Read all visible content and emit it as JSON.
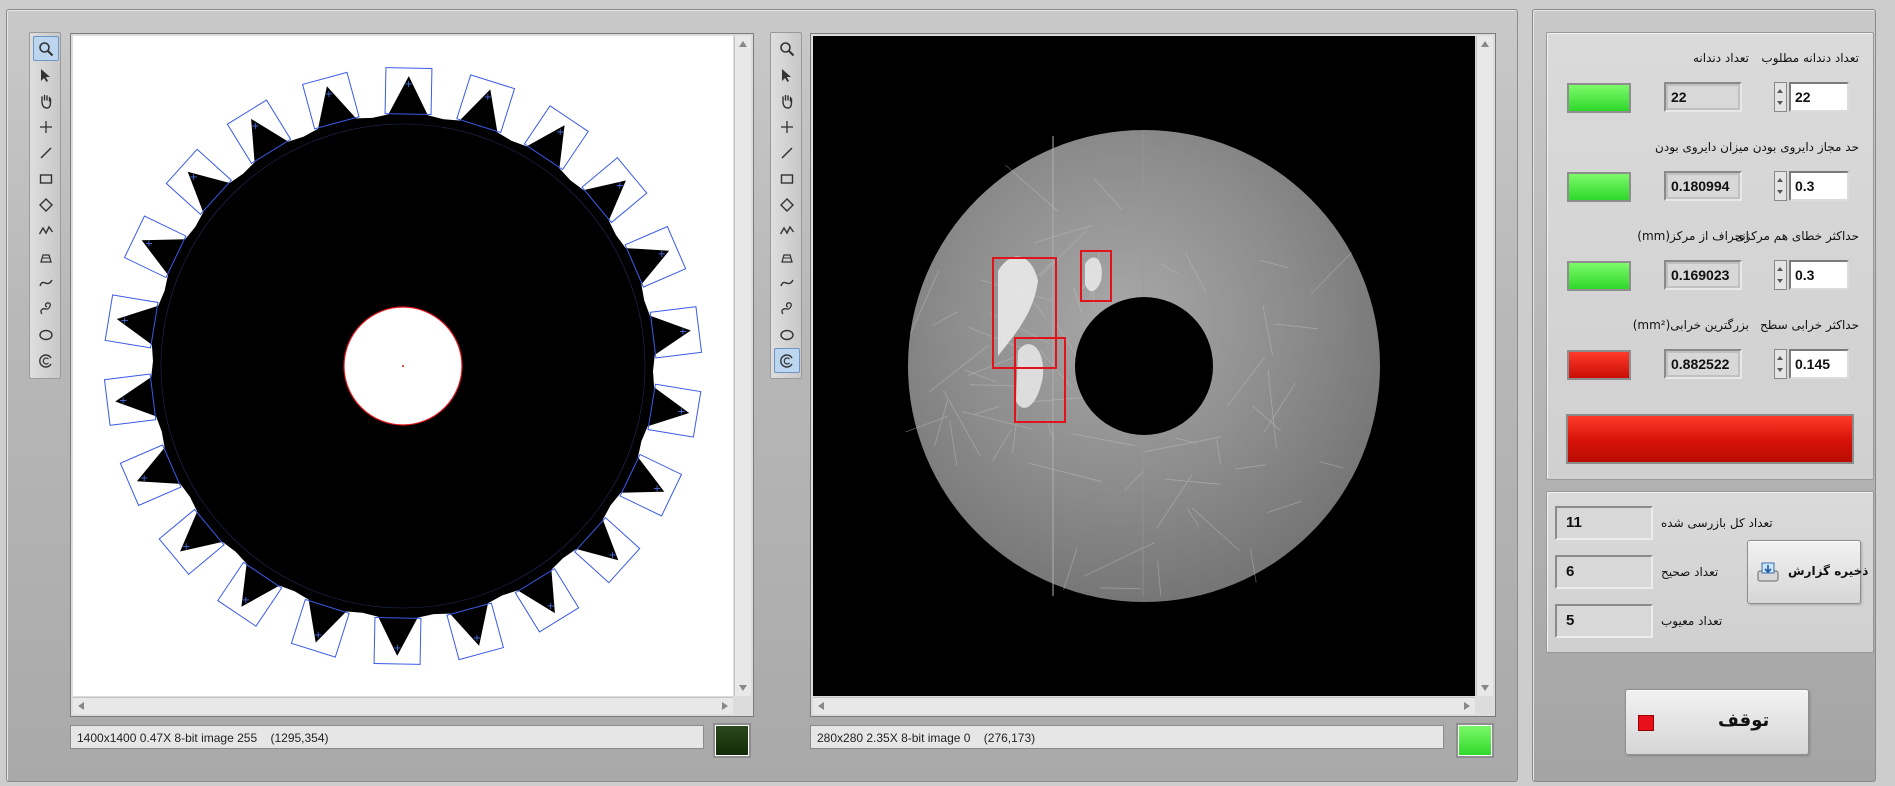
{
  "left_viewer": {
    "status": "1400x1400 0.47X 8-bit image 255    (1295,354)",
    "led_color": "#1a3a0c"
  },
  "right_viewer": {
    "status": "280x280 2.35X 8-bit image 0    (276,173)",
    "led_color": "#3ff03a"
  },
  "tools": [
    "zoom-icon",
    "pointer-icon",
    "pan-hand-icon",
    "crosshair-icon",
    "line-icon",
    "rectangle-icon",
    "rotated-rectangle-icon",
    "polyline-icon",
    "annulus-sector-icon",
    "freehand-line-icon",
    "freehand-shape-icon",
    "oval-icon",
    "annulus-icon"
  ],
  "params": {
    "rows": [
      {
        "param_label": "تعداد دندانه مطلوب",
        "param_value": "22",
        "measure_label": "تعداد دندانه",
        "measure_value": "22",
        "led": "green"
      },
      {
        "param_label": "حد مجاز دایروی بودن",
        "param_value": "0.3",
        "measure_label": "میزان دایروی بودن",
        "measure_value": "0.180994",
        "led": "green"
      },
      {
        "param_label": "حداکثر خطای هم مرکزی",
        "param_value": "0.3",
        "measure_label": "انحراف از مرکز(mm)",
        "measure_value": "0.169023",
        "led": "green"
      },
      {
        "param_label": "حداکثر خرابی سطح",
        "param_value": "0.145",
        "measure_label": "بزرگترین خرابی(mm²)",
        "measure_value": "0.882522",
        "led": "red"
      }
    ],
    "result_bar_color": "#dd1a10"
  },
  "counts": {
    "total_label": "تعداد کل بازرسی شده",
    "total_value": "11",
    "good_label": "تعداد صحیح",
    "good_value": "6",
    "bad_label": "تعداد معیوب",
    "bad_value": "5",
    "save_report_label": "ذخیره گزارش"
  },
  "stop_button": {
    "label": "توقف"
  }
}
